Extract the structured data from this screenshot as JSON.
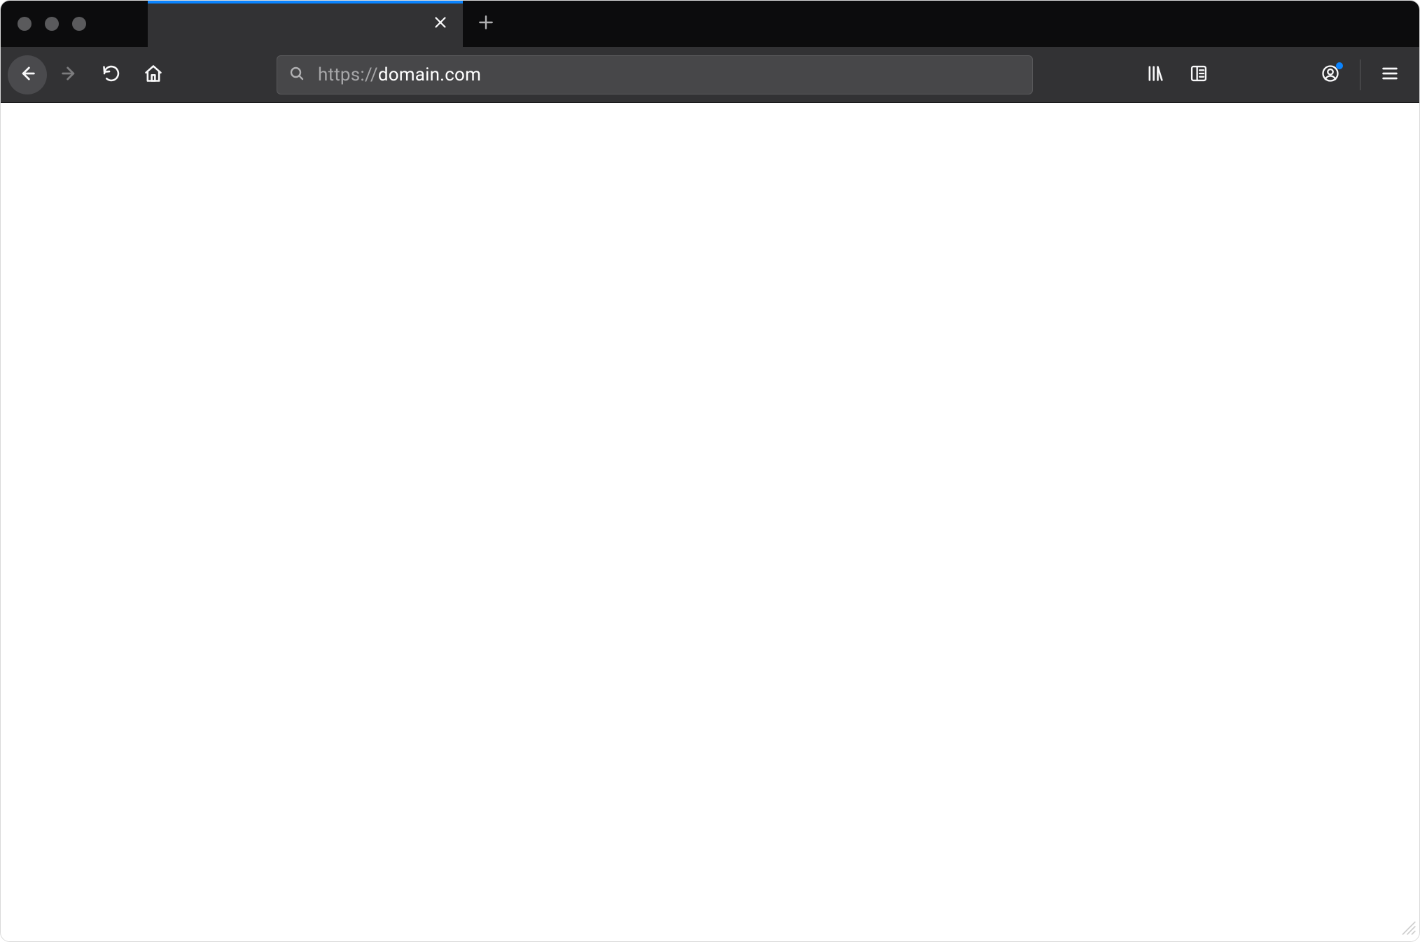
{
  "tab": {
    "title": "",
    "loading": true
  },
  "addressbar": {
    "scheme": "https://",
    "host": "domain.com",
    "path": ""
  },
  "icons": {
    "back": "back-arrow-icon",
    "forward": "forward-arrow-icon",
    "reload": "reload-icon",
    "home": "home-icon",
    "search": "search-icon",
    "library": "library-icon",
    "sidebar": "reader-view-sidebar-icon",
    "account": "account-icon",
    "menu": "hamburger-menu-icon",
    "close_tab": "close-icon",
    "new_tab": "plus-icon",
    "resize": "resize-grip-icon"
  },
  "colors": {
    "accent": "#0a84ff",
    "titlebar_bg": "#0c0c0d",
    "toolbar_bg": "#323234",
    "address_bg": "#474749"
  }
}
